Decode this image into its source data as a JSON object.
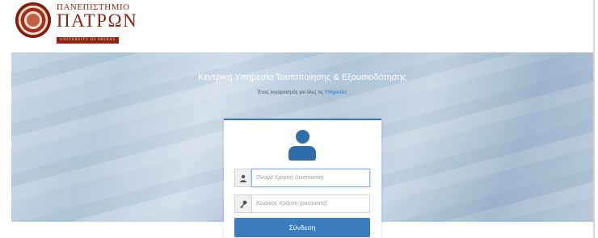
{
  "header": {
    "logo": {
      "line1": "ΠΑΝΕΠΙΣΤΗΜΙΟ",
      "line2": "ΠΑΤΡΩΝ",
      "line3": "UNIVERSITY OF PATRAS"
    }
  },
  "hero": {
    "title": "Κεντρική Υπηρεσία Ταυτοποίησης & Εξουσιοδότησης",
    "subtitle_prefix": "Ένας λογαριασμός για όλες τις ",
    "subtitle_link": "Υπηρεσίες"
  },
  "login": {
    "username_placeholder": "Όνομα Χρήστη (username)",
    "password_placeholder": "Κωδικός Χρήστη (password)",
    "submit_label": "Σύνδεση",
    "icons": {
      "user": "user-icon",
      "username_addon": "person-icon",
      "password_addon": "key-icon"
    }
  },
  "colors": {
    "brand_red": "#8e2413",
    "primary_blue": "#3b7dbc",
    "user_icon": "#2f6ea8"
  }
}
